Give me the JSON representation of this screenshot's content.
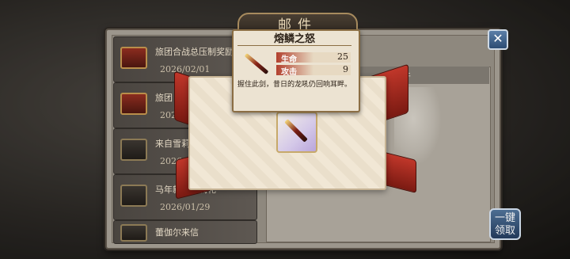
{
  "window": {
    "title": "邮件",
    "close_symbol": "✕"
  },
  "mail_list": [
    {
      "title": "旅团合战总压制奖励",
      "date": "2026/02/01",
      "icon": "red-chest-icon"
    },
    {
      "title": "旅团",
      "date": "202",
      "icon": "red-chest-icon"
    },
    {
      "title": "来自雪莉",
      "date": "2026/0",
      "icon": "dark-chest-icon"
    },
    {
      "title": "马年新服专属礼",
      "date": "2026/01/29",
      "icon": "dark-chest-icon"
    },
    {
      "title": "蕾伽尔来信",
      "date": "",
      "icon": "dark-chest-icon"
    }
  ],
  "detail": {
    "header_text": "件"
  },
  "collect_all": {
    "label_line1": "一键",
    "label_line2": "领取"
  },
  "tooltip": {
    "item_name": "熔鳞之怒",
    "stats": [
      {
        "label": "生命",
        "value": "25"
      },
      {
        "label": "攻击",
        "value": "9"
      }
    ],
    "description": "握住此剑，昔日的龙吼仍回响耳畔。"
  },
  "colors": {
    "ribbon": "#c0372a",
    "tooltip_bg": "#ece3d2",
    "button_blue": "#2c4c73"
  }
}
